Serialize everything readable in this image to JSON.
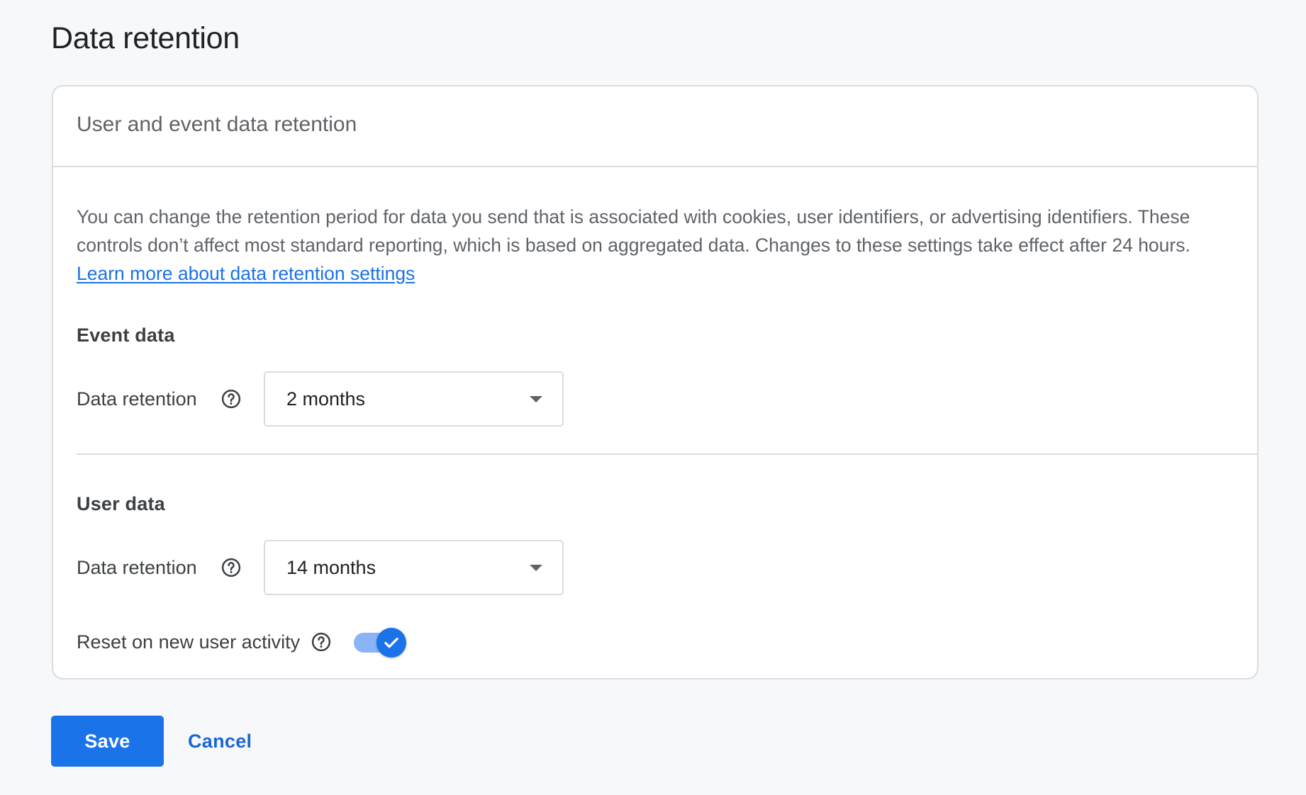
{
  "page": {
    "title": "Data retention"
  },
  "card": {
    "title": "User and event data retention",
    "description": "You can change the retention period for data you send that is associated with cookies, user identifiers, or advertising identifiers. These controls don’t affect most standard reporting, which is based on aggregated data. Changes to these settings take effect after 24 hours.",
    "learn_more_link": "Learn more about data retention settings"
  },
  "event_data": {
    "heading": "Event data",
    "field_label": "Data retention",
    "help_icon": "help-circle-icon",
    "selected_value": "2 months"
  },
  "user_data": {
    "heading": "User data",
    "field_label": "Data retention",
    "help_icon": "help-circle-icon",
    "selected_value": "14 months",
    "reset_label": "Reset on new user activity",
    "reset_enabled": true
  },
  "actions": {
    "save_label": "Save",
    "cancel_label": "Cancel"
  },
  "colors": {
    "primary": "#1a73e8",
    "toggle_track": "#8ab4f8",
    "border": "#dadce0",
    "background": "#f7f8fa"
  }
}
